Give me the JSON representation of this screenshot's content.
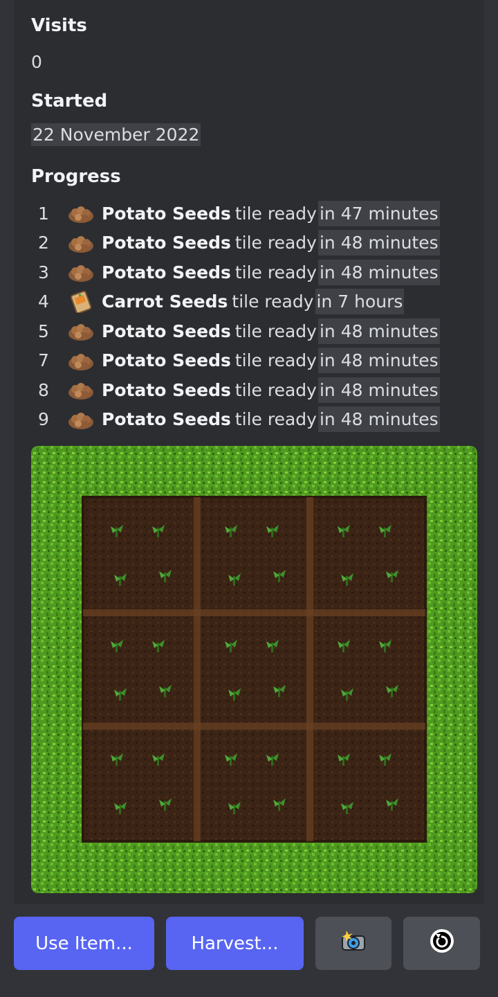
{
  "embed": {
    "fields": {
      "visits": {
        "name": "Visits",
        "value": "0"
      },
      "started": {
        "name": "Started",
        "value": "22 November 2022"
      },
      "progress": {
        "name": "Progress"
      }
    },
    "progress": [
      {
        "num": "1",
        "icon": "potato-seeds-icon",
        "seed": "Potato Seeds",
        "mid": "tile ready",
        "time": "in 47 minutes"
      },
      {
        "num": "2",
        "icon": "potato-seeds-icon",
        "seed": "Potato Seeds",
        "mid": "tile ready",
        "time": "in 48 minutes"
      },
      {
        "num": "3",
        "icon": "potato-seeds-icon",
        "seed": "Potato Seeds",
        "mid": "tile ready",
        "time": "in 48 minutes"
      },
      {
        "num": "4",
        "icon": "carrot-seeds-icon",
        "seed": "Carrot Seeds",
        "mid": "tile ready",
        "time": "in 7 hours"
      },
      {
        "num": "5",
        "icon": "potato-seeds-icon",
        "seed": "Potato Seeds",
        "mid": "tile ready",
        "time": "in 48 minutes"
      },
      {
        "num": "7",
        "icon": "potato-seeds-icon",
        "seed": "Potato Seeds",
        "mid": "tile ready",
        "time": "in 48 minutes"
      },
      {
        "num": "8",
        "icon": "potato-seeds-icon",
        "seed": "Potato Seeds",
        "mid": "tile ready",
        "time": "in 48 minutes"
      },
      {
        "num": "9",
        "icon": "potato-seeds-icon",
        "seed": "Potato Seeds",
        "mid": "tile ready",
        "time": "in 48 minutes"
      }
    ],
    "farm_image": {
      "icon": "farm-plot-image",
      "grid": "3x3",
      "tiles_with_sprouts": 9
    }
  },
  "buttons": {
    "use_item": "Use Item...",
    "harvest": "Harvest...",
    "camera": {
      "icon": "camera-flash-icon"
    },
    "refresh": {
      "icon": "refresh-icon"
    }
  },
  "colors": {
    "background": "#313338",
    "embed": "#2b2d31",
    "primary_button": "#5865f2",
    "secondary_button": "#4e5058",
    "grass": "#4f9a20",
    "soil": "#3b2415"
  }
}
